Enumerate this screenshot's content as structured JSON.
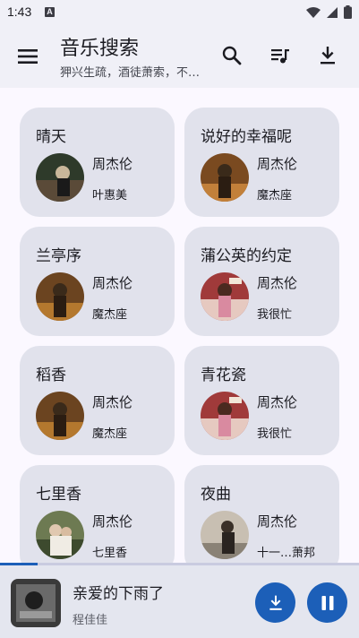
{
  "status_bar": {
    "time": "1:43",
    "notification_badge": "A"
  },
  "app_bar": {
    "title": "音乐搜索",
    "subtitle": "狎兴生疏，酒徒萧索，不…",
    "icons": [
      "menu-icon",
      "search-icon",
      "playlist-icon",
      "download-icon"
    ]
  },
  "songs": [
    {
      "title": "晴天",
      "artist": "周杰伦",
      "album": "叶惠美",
      "cover_color": "#2e3a2a"
    },
    {
      "title": "说好的幸福呢",
      "artist": "周杰伦",
      "album": "魔杰座",
      "cover_color": "#7a4a20"
    },
    {
      "title": "兰亭序",
      "artist": "周杰伦",
      "album": "魔杰座",
      "cover_color": "#6b4420"
    },
    {
      "title": "蒲公英的约定",
      "artist": "周杰伦",
      "album": "我很忙",
      "cover_color": "#a03a3a"
    },
    {
      "title": "稻香",
      "artist": "周杰伦",
      "album": "魔杰座",
      "cover_color": "#6b4420"
    },
    {
      "title": "青花瓷",
      "artist": "周杰伦",
      "album": "我很忙",
      "cover_color": "#a03a3a"
    },
    {
      "title": "七里香",
      "artist": "周杰伦",
      "album": "七里香",
      "cover_color": "#6d7a52"
    },
    {
      "title": "夜曲",
      "artist": "周杰伦",
      "album": "十一…萧邦",
      "cover_color": "#c8bfb2"
    }
  ],
  "now_playing": {
    "title": "亲爱的下雨了",
    "artist": "程佳佳",
    "progress_fraction": 0.105
  },
  "colors": {
    "accent": "#1c5fb8",
    "card": "#e1e2ec",
    "appbar": "#f0f0f7"
  }
}
